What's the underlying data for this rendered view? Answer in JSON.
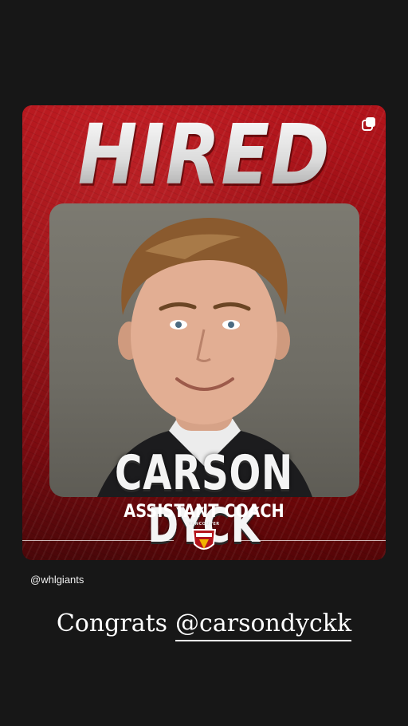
{
  "post": {
    "headline": "HIRED",
    "name": "CARSON DYCK",
    "role": "ASSISTANT COACH",
    "logo_text": "VANCOUVER",
    "copy_icon": "copy-icon"
  },
  "story": {
    "account": "@whlgiants",
    "caption_text": "Congrats",
    "mention": "@carsondyckk"
  },
  "colors": {
    "background": "#171717",
    "brand_red": "#b3141b",
    "dark_red": "#7a0b10",
    "text": "#ffffff"
  }
}
